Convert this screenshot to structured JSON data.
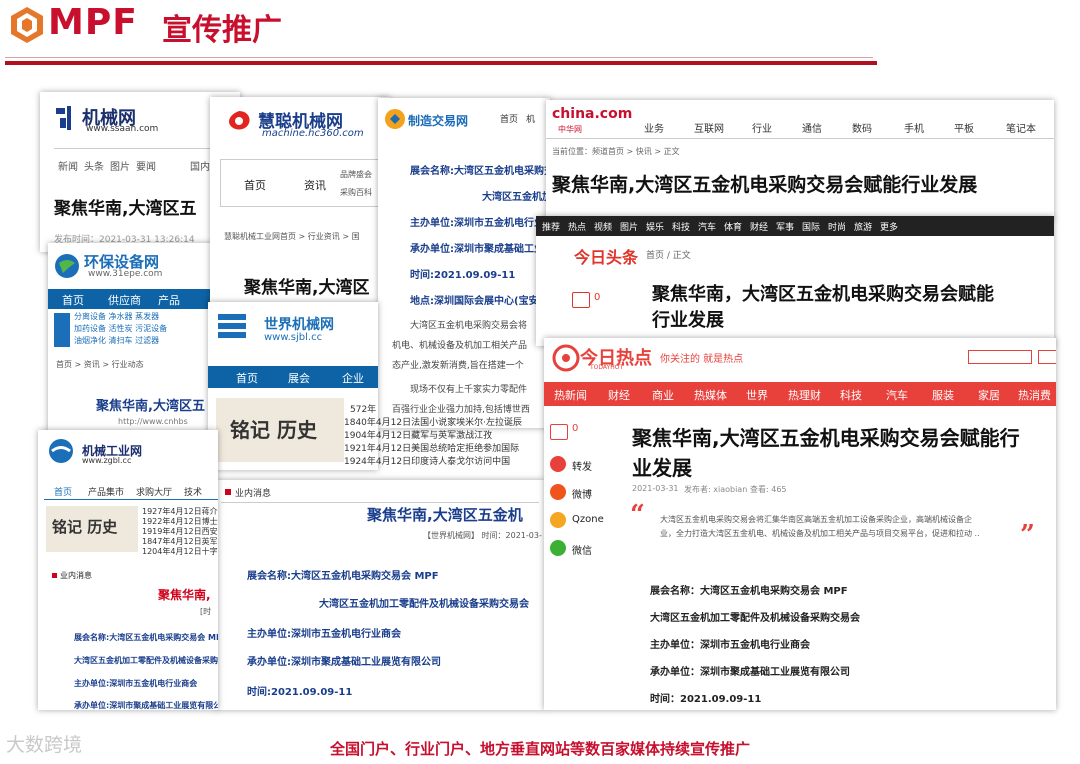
{
  "header": {
    "brand": "MPF",
    "subtitle": "宣传推广"
  },
  "footer": {
    "caption": "全国门户、行业门户、地方垂直网站等数百家媒体持续宣传推广",
    "watermark": "大数跨境"
  },
  "headline": "聚焦华南,大湾区五金机电采购交易会赋能行业发展",
  "headline_alt": "聚焦华南，大湾区五金机电采购交易会赋能行业发展",
  "event": {
    "name_label": "展会名称:大湾区五金机电采购交易会 MPF",
    "name_line2": "大湾区五金机加工零配件及机械设备采购交易会",
    "host": "主办单位:深圳市五金机电行业商会",
    "organizer": "承办单位:深圳市聚成基础工业展览有限公司",
    "time": "时间:2021.09.09-11",
    "place": "地点:深圳国际会展中心(宝安",
    "name_label_cn": "展会名称：大湾区五金机电采购交易会 MPF",
    "name_line2_cn": "大湾区五金机加工零配件及机械设备采购交易会",
    "host_cn": "主办单位：深圳市五金机电行业商会",
    "organizer_cn": "承办单位：深圳市聚成基础工业展览有限公司",
    "time_cn": "时间：2021.09.09-11"
  },
  "sites": {
    "ssaah": {
      "logo": "机械网",
      "url": "www.ssaah.com",
      "nav": [
        "新闻",
        "头条",
        "图片",
        "要闻",
        "国内"
      ],
      "headline": "聚焦华南,大湾区五",
      "date": "发布时间：2021-03-31 13:26:14"
    },
    "hc360": {
      "logo": "慧聪机械网",
      "url": "machine.hc360.com",
      "nav": [
        "首页",
        "资讯"
      ],
      "nav_sub": [
        "品牌盛会",
        "采购百科"
      ],
      "breadcrumb": "慧聪机械工业网首页 > 行业资讯 > 国",
      "headline": "聚焦华南,大湾区"
    },
    "epe": {
      "logo": "环保设备网",
      "url": "www.31epe.com",
      "nav": [
        "首页",
        "供应商",
        "产品"
      ],
      "cats": [
        "分离设备 净水器 蒸发器",
        "加药设备 活性炭 污泥设备",
        "油烟净化 清扫车 过滤器"
      ],
      "crumb": "首页 > 资讯 > 行业动态",
      "headline": "聚焦华南,大湾区五",
      "link": "http://www.cnhbs"
    },
    "sjbl": {
      "logo": "世界机械网",
      "url": "www.sjbl.cc",
      "nav": [
        "首页",
        "展会",
        "企业"
      ],
      "history": [
        "572年",
        "1840年4月12日法国小说家埃米尔·左拉诞辰",
        "1904年4月12日藏军与英军激战江孜",
        "1921年4月12日美国总统哈定拒绝参加国际",
        "1924年4月12日印度诗人泰戈尔访问中国"
      ],
      "history_title": "铭记 历史",
      "section": "业内消息",
      "headline": "聚焦华南,大湾区五金机",
      "source": "【世界机械网】 时间：2021-03-"
    },
    "zgbl": {
      "logo": "机械工业网",
      "url": "www.zgbl.cc",
      "nav": [
        "首页",
        "产品集市",
        "求购大厅",
        "技术"
      ],
      "history": [
        "1927年4月12日蒋介",
        "1922年4月12日博士",
        "1919年4月12日西安",
        "1847年4月12日英军",
        "1204年4月12日十字"
      ],
      "history_title": "铭记 历史",
      "section": "业内消息",
      "headline": "聚焦华南,",
      "page_hint": "[时"
    },
    "zzjy": {
      "logo": "制造交易网",
      "nav": [
        "首页",
        "机"
      ],
      "paragraph": [
        "大湾区五金机电采购交易会将",
        "机电、机械设备及机加工相关产品",
        "态产业,激发新消费,旨在搭建一个"
      ],
      "para2": [
        "现场不仅有上千家实力零配件",
        "百强行业企业强力加持,包括博世西"
      ]
    },
    "china": {
      "logo": "china.com",
      "logo_sub": "中华网",
      "nav": [
        "业务",
        "互联网",
        "行业",
        "通信",
        "数码",
        "手机",
        "平板",
        "笔记本"
      ],
      "crumb": "当前位置：频道首页 > 快讯 > 正文"
    },
    "toutiao": {
      "topnav": [
        "推荐",
        "热点",
        "视频",
        "图片",
        "娱乐",
        "科技",
        "汽车",
        "体育",
        "财经",
        "军事",
        "国际",
        "时尚",
        "旅游",
        "更多"
      ],
      "logo": "今日头条",
      "crumb": "首页 / 正文",
      "comment_count": "0"
    },
    "jrrd": {
      "logo": "今日热点",
      "logo_en": "TODAYHOT",
      "tagline": "你关注的 就是热点",
      "nav": [
        "热新闻",
        "财经",
        "商业",
        "热媒体",
        "世界",
        "热理财",
        "科技",
        "汽车",
        "服装",
        "家居",
        "热消费"
      ],
      "comment_count": "0",
      "share": [
        "转发",
        "微博",
        "Qzone",
        "微信"
      ],
      "meta_date": "2021-03-31",
      "meta_author": "发布者: xiaobian",
      "meta_views": "查看: 465",
      "quote": [
        "大湾区五金机电采购交易会将汇集华南区高端五金机加工设备采购企业，高端机械设备企",
        "业，全力打造大湾区五金机电、机械设备及机加工相关产品与项目交易平台，促进和拉动 .."
      ]
    }
  },
  "colors": {
    "brand_red": "#c8102e",
    "nav_blue": "#0d63a5",
    "jrrd_red": "#e8413c",
    "toutiao_red": "#e0352b"
  }
}
